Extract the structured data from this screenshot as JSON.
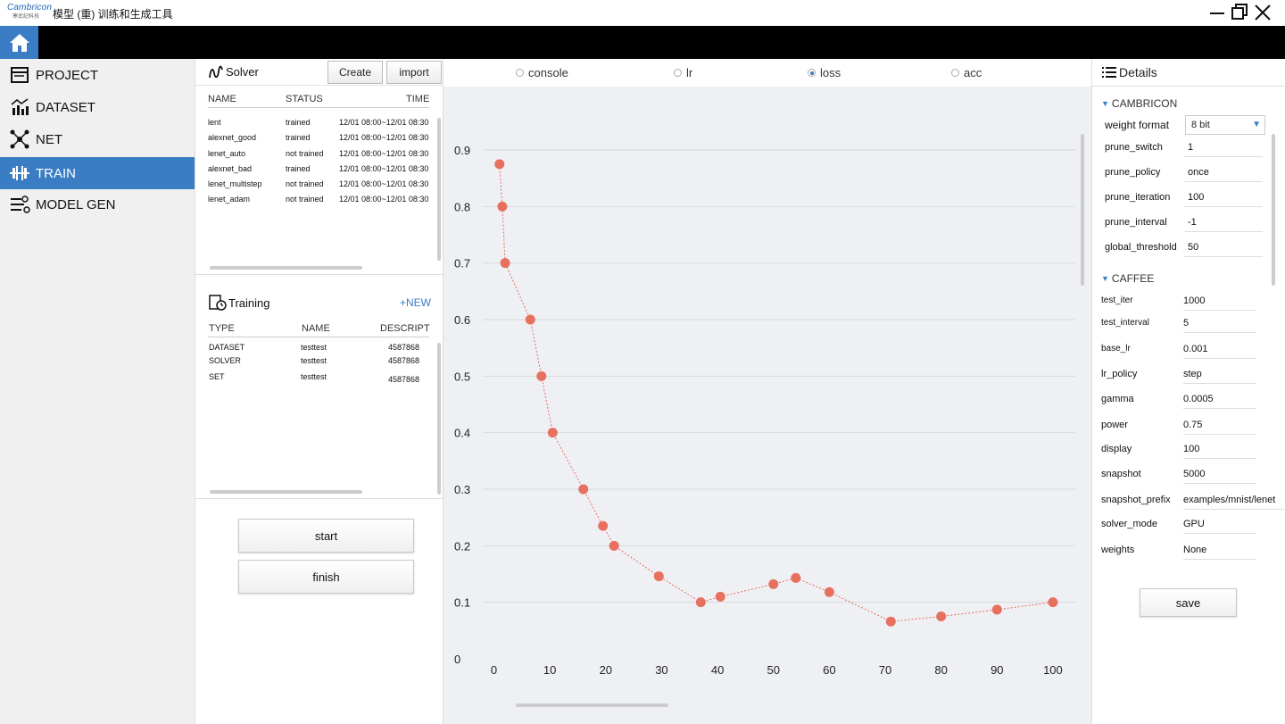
{
  "app": {
    "logo_text": "Cambricon",
    "logo_subtext": "寒武纪科技",
    "title": "模型 (重) 训练和生成工具"
  },
  "sidebar": {
    "items": [
      {
        "label": "PROJECT",
        "icon": "project-icon",
        "active": false
      },
      {
        "label": "DATASET",
        "icon": "dataset-icon",
        "active": false
      },
      {
        "label": "NET",
        "icon": "net-icon",
        "active": false
      },
      {
        "label": "TRAIN",
        "icon": "train-icon",
        "active": true
      },
      {
        "label": "MODEL GEN",
        "icon": "model-gen-icon",
        "active": false
      }
    ]
  },
  "solver": {
    "title": "Solver",
    "create_label": "Create",
    "import_label": "import",
    "columns": [
      "NAME",
      "STATUS",
      "TIME"
    ],
    "rows": [
      {
        "name": "lent",
        "status": "trained",
        "time": "12/01 08:00~12/01 08:30"
      },
      {
        "name": "alexnet_good",
        "status": "trained",
        "time": "12/01 08:00~12/01 08:30"
      },
      {
        "name": "lenet_auto",
        "status": "not trained",
        "time": "12/01 08:00~12/01 08:30"
      },
      {
        "name": "alexnet_bad",
        "status": "trained",
        "time": "12/01 08:00~12/01 08:30"
      },
      {
        "name": "lenet_multistep",
        "status": "not trained",
        "time": "12/01 08:00~12/01 08:30"
      },
      {
        "name": "lenet_adam",
        "status": "not trained",
        "time": "12/01 08:00~12/01 08:30"
      }
    ]
  },
  "training": {
    "title": "Training",
    "new_label": "+NEW",
    "columns": [
      "TYPE",
      "NAME",
      "DESCRIPT"
    ],
    "rows": [
      {
        "type": "DATASET",
        "name": "testtest",
        "descript": "4587868"
      },
      {
        "type": "SOLVER",
        "name": "testtest",
        "descript": "4587868"
      },
      {
        "type": "SET",
        "name": "testtest",
        "descript": "4587868"
      }
    ]
  },
  "actions": {
    "start_label": "start",
    "finish_label": "finish"
  },
  "chart_tabs": [
    {
      "label": "console",
      "checked": false
    },
    {
      "label": "lr",
      "checked": false
    },
    {
      "label": "loss",
      "checked": true
    },
    {
      "label": "acc",
      "checked": false
    }
  ],
  "chart_data": {
    "type": "line",
    "title": "",
    "xlabel": "",
    "ylabel": "",
    "xlim": [
      -2,
      104
    ],
    "ylim": [
      0,
      0.9
    ],
    "x_ticks": [
      0,
      10,
      20,
      30,
      40,
      50,
      60,
      70,
      80,
      90,
      100
    ],
    "y_ticks": [
      0,
      0.1,
      0.2,
      0.3,
      0.4,
      0.5,
      0.6,
      0.7,
      0.8,
      0.9
    ],
    "grid": true,
    "color": "#e8705f",
    "series": [
      {
        "name": "",
        "x": [
          1,
          1.5,
          2,
          6.5,
          8.5,
          10.5,
          16,
          19.5,
          21.5,
          29.5,
          37,
          40.5,
          50,
          54,
          60,
          71,
          80,
          90,
          100
        ],
        "y": [
          0.875,
          0.8,
          0.7,
          0.6,
          0.5,
          0.4,
          0.3,
          0.235,
          0.2,
          0.146,
          0.1,
          0.11,
          0.132,
          0.143,
          0.118,
          0.066,
          0.075,
          0.087,
          0.1
        ]
      }
    ]
  },
  "details": {
    "title": "Details",
    "cambricon": {
      "title": "CAMBRICON",
      "weight_format_label": "weight format",
      "weight_format_value": "8 bit",
      "params": [
        {
          "key": "prune_switch",
          "value": "1"
        },
        {
          "key": "prune_policy",
          "value": "once"
        },
        {
          "key": "prune_iteration",
          "value": "100"
        },
        {
          "key": "prune_interval",
          "value": "-1"
        },
        {
          "key": "global_threshold",
          "value": "50"
        }
      ]
    },
    "caffee": {
      "title": "CAFFEE",
      "params": [
        {
          "key": "test_iter",
          "value": "1000"
        },
        {
          "key": "test_interval",
          "value": "5"
        },
        {
          "key": "base_lr",
          "value": "0.001"
        },
        {
          "key": "lr_policy",
          "value": "step"
        },
        {
          "key": "gamma",
          "value": "0.0005"
        },
        {
          "key": "power",
          "value": "0.75"
        },
        {
          "key": "display",
          "value": "100"
        },
        {
          "key": "snapshot",
          "value": "5000"
        },
        {
          "key": "snapshot_prefix",
          "value": "examples/mnist/lenet"
        },
        {
          "key": "solver_mode",
          "value": "GPU"
        },
        {
          "key": "weights",
          "value": "None"
        }
      ]
    },
    "save_label": "save"
  }
}
